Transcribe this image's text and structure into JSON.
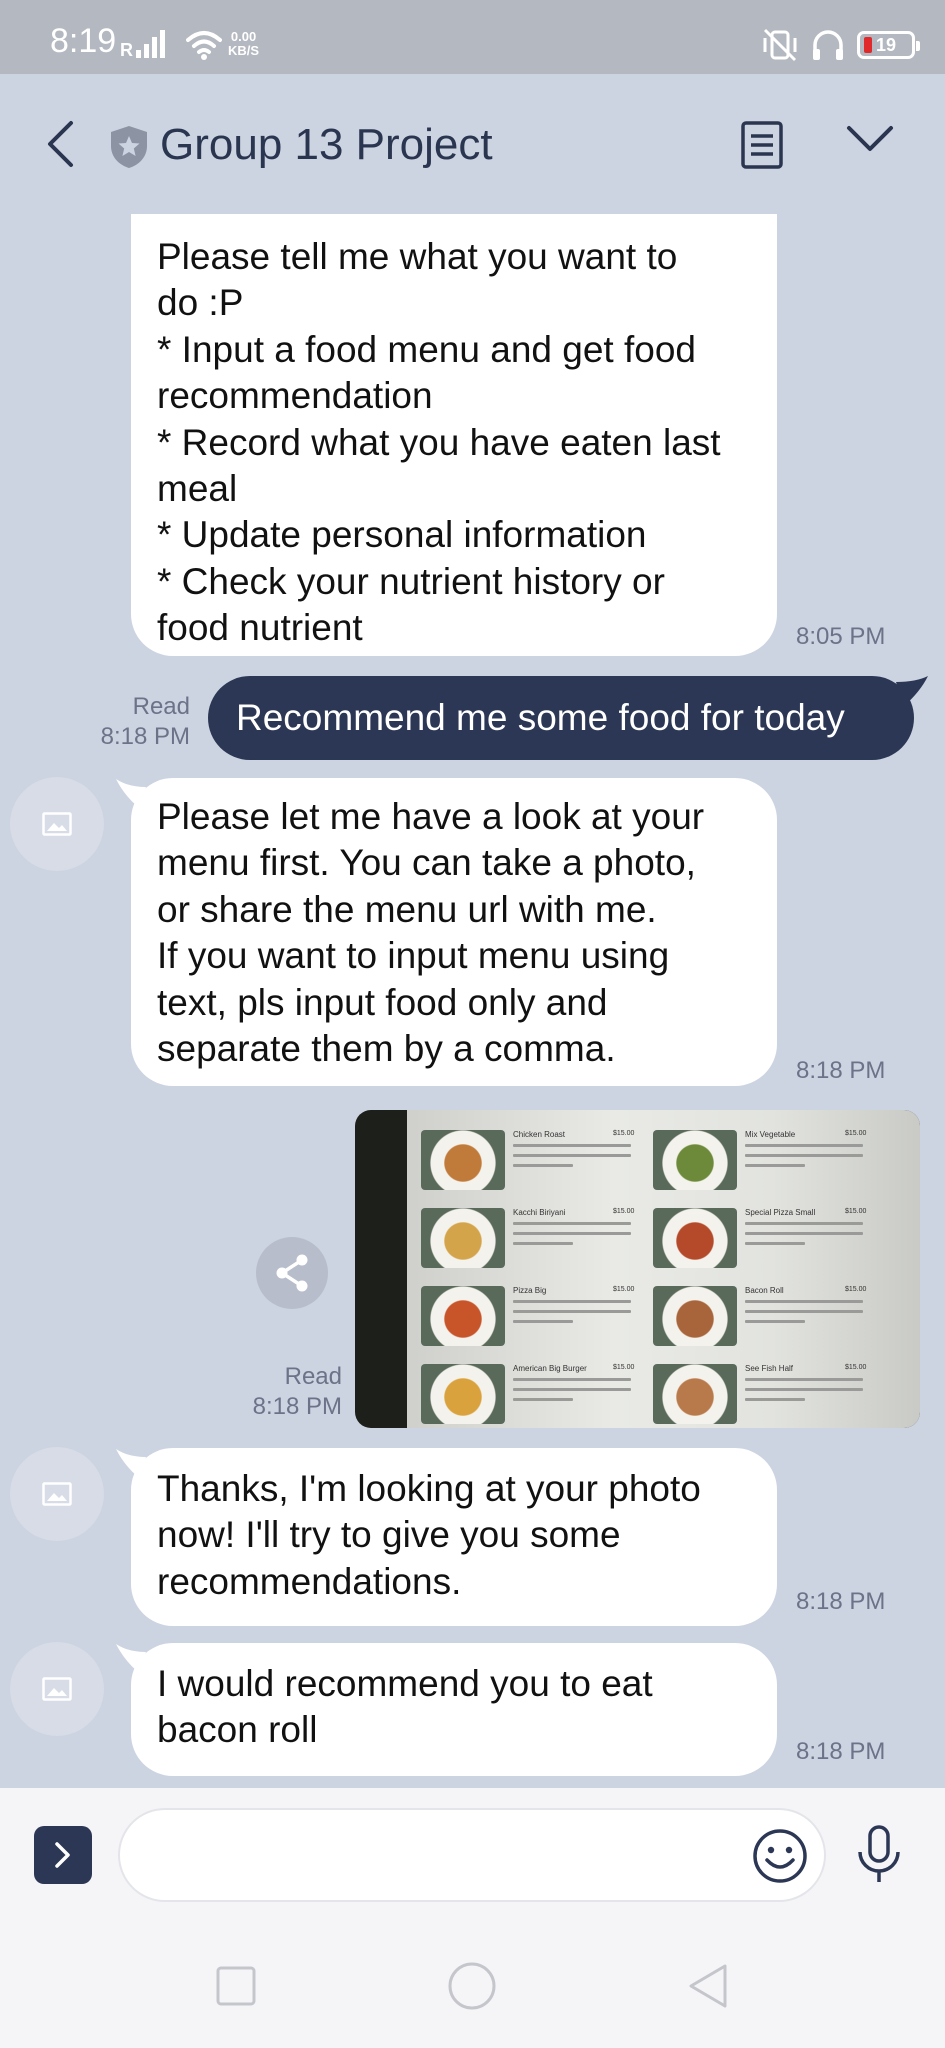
{
  "status_bar": {
    "time": "8:19",
    "speed_value": "0.00",
    "speed_unit": "KB/S",
    "battery": "19"
  },
  "header": {
    "title": "Group 13 Project"
  },
  "messages": {
    "m1": {
      "text": "Please tell me what you want to\ndo :P\n* Input a food menu and get food\nrecommendation\n* Record what you have eaten last\nmeal\n* Update personal information\n* Check your nutrient history or\nfood nutrient",
      "time": "8:05 PM"
    },
    "m2": {
      "text": "Recommend me some food for today",
      "read": "Read",
      "time": "8:18 PM"
    },
    "m3": {
      "text": "Please let me have a look at your\nmenu first. You can take a photo,\nor share the menu url with me.\nIf you want to input menu using\ntext, pls input food only and\nseparate them by a comma.",
      "time": "8:18 PM"
    },
    "m4": {
      "read": "Read",
      "time": "8:18 PM",
      "menu_items": [
        {
          "name": "Chicken Roast",
          "price": "$15.00"
        },
        {
          "name": "Mix Vegetable",
          "price": "$15.00"
        },
        {
          "name": "Kacchi Biriyani",
          "price": "$15.00"
        },
        {
          "name": "Special Pizza Small",
          "price": "$15.00"
        },
        {
          "name": "Pizza Big",
          "price": "$15.00"
        },
        {
          "name": "Bacon Roll",
          "price": "$15.00"
        },
        {
          "name": "American Big Burger",
          "price": "$15.00"
        },
        {
          "name": "See Fish Half",
          "price": "$15.00"
        }
      ]
    },
    "m5": {
      "text": "Thanks, I'm looking at your photo\nnow! I'll try to give you some\nrecommendations.",
      "time": "8:18 PM"
    },
    "m6": {
      "text": "I would recommend you to eat\nbacon roll",
      "time": "8:18 PM"
    }
  },
  "input": {
    "placeholder": ""
  },
  "colors": {
    "chat_bg": "#ccd3e1",
    "outgoing_bubble": "#2b3754",
    "incoming_bubble": "#ffffff",
    "header_text": "#2a3550"
  }
}
